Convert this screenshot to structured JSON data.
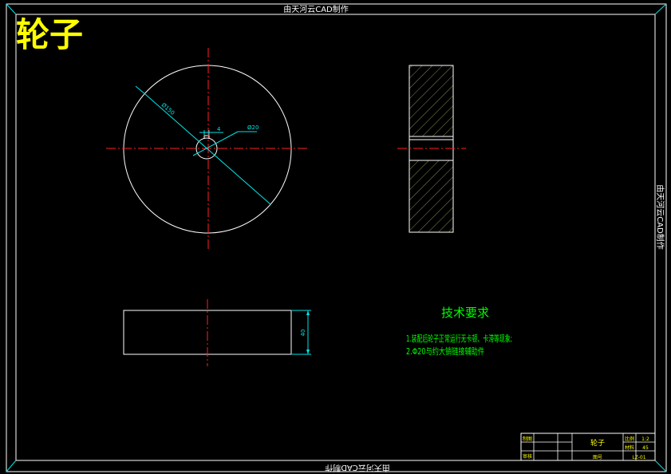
{
  "drawing": {
    "title": "轮子",
    "watermark_top": "由天河云CAD制作",
    "watermark_right": "由天河云CAD制作",
    "watermark_bottom": "由天河云CAD制作",
    "colors": {
      "background": "#000000",
      "frame": "#ffffff",
      "centerline": "#ff2020",
      "dimension": "#00e5e5",
      "notes": "#00ff00",
      "title": "#ffff00",
      "hatch": "#c8c870"
    }
  },
  "dimensions": {
    "outer_diameter": "Ø150",
    "bore_diameter": "Ø20",
    "keyway_width": "4",
    "thickness": "40"
  },
  "technical_requirements": {
    "heading": "技术要求",
    "items": [
      "1.装配后轮子正常运行无卡顿、卡滞等现象;",
      "2.Φ20与约大销链接辅助件"
    ]
  },
  "title_block": {
    "part_name": "轮子",
    "label_designer": "制图",
    "label_checker": "审核",
    "label_scale": "比例",
    "scale_value": "1:2",
    "label_material": "材料",
    "material_value": "45",
    "label_drawing_no": "图号",
    "drawing_no": "LZ-01"
  }
}
